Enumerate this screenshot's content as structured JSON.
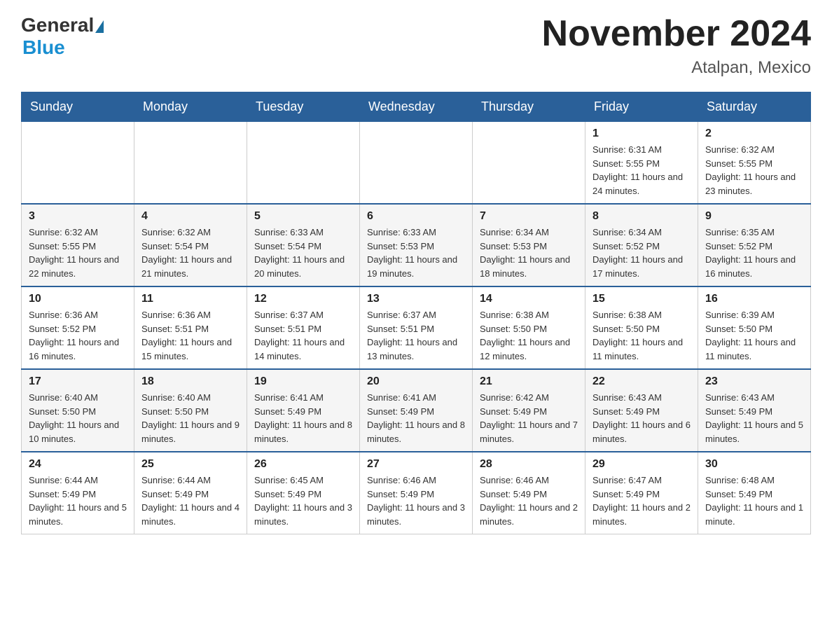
{
  "header": {
    "logo_general": "General",
    "logo_blue": "Blue",
    "title": "November 2024",
    "subtitle": "Atalpan, Mexico"
  },
  "days_of_week": [
    "Sunday",
    "Monday",
    "Tuesday",
    "Wednesday",
    "Thursday",
    "Friday",
    "Saturday"
  ],
  "weeks": [
    [
      {
        "day": "",
        "info": ""
      },
      {
        "day": "",
        "info": ""
      },
      {
        "day": "",
        "info": ""
      },
      {
        "day": "",
        "info": ""
      },
      {
        "day": "",
        "info": ""
      },
      {
        "day": "1",
        "info": "Sunrise: 6:31 AM\nSunset: 5:55 PM\nDaylight: 11 hours and 24 minutes."
      },
      {
        "day": "2",
        "info": "Sunrise: 6:32 AM\nSunset: 5:55 PM\nDaylight: 11 hours and 23 minutes."
      }
    ],
    [
      {
        "day": "3",
        "info": "Sunrise: 6:32 AM\nSunset: 5:55 PM\nDaylight: 11 hours and 22 minutes."
      },
      {
        "day": "4",
        "info": "Sunrise: 6:32 AM\nSunset: 5:54 PM\nDaylight: 11 hours and 21 minutes."
      },
      {
        "day": "5",
        "info": "Sunrise: 6:33 AM\nSunset: 5:54 PM\nDaylight: 11 hours and 20 minutes."
      },
      {
        "day": "6",
        "info": "Sunrise: 6:33 AM\nSunset: 5:53 PM\nDaylight: 11 hours and 19 minutes."
      },
      {
        "day": "7",
        "info": "Sunrise: 6:34 AM\nSunset: 5:53 PM\nDaylight: 11 hours and 18 minutes."
      },
      {
        "day": "8",
        "info": "Sunrise: 6:34 AM\nSunset: 5:52 PM\nDaylight: 11 hours and 17 minutes."
      },
      {
        "day": "9",
        "info": "Sunrise: 6:35 AM\nSunset: 5:52 PM\nDaylight: 11 hours and 16 minutes."
      }
    ],
    [
      {
        "day": "10",
        "info": "Sunrise: 6:36 AM\nSunset: 5:52 PM\nDaylight: 11 hours and 16 minutes."
      },
      {
        "day": "11",
        "info": "Sunrise: 6:36 AM\nSunset: 5:51 PM\nDaylight: 11 hours and 15 minutes."
      },
      {
        "day": "12",
        "info": "Sunrise: 6:37 AM\nSunset: 5:51 PM\nDaylight: 11 hours and 14 minutes."
      },
      {
        "day": "13",
        "info": "Sunrise: 6:37 AM\nSunset: 5:51 PM\nDaylight: 11 hours and 13 minutes."
      },
      {
        "day": "14",
        "info": "Sunrise: 6:38 AM\nSunset: 5:50 PM\nDaylight: 11 hours and 12 minutes."
      },
      {
        "day": "15",
        "info": "Sunrise: 6:38 AM\nSunset: 5:50 PM\nDaylight: 11 hours and 11 minutes."
      },
      {
        "day": "16",
        "info": "Sunrise: 6:39 AM\nSunset: 5:50 PM\nDaylight: 11 hours and 11 minutes."
      }
    ],
    [
      {
        "day": "17",
        "info": "Sunrise: 6:40 AM\nSunset: 5:50 PM\nDaylight: 11 hours and 10 minutes."
      },
      {
        "day": "18",
        "info": "Sunrise: 6:40 AM\nSunset: 5:50 PM\nDaylight: 11 hours and 9 minutes."
      },
      {
        "day": "19",
        "info": "Sunrise: 6:41 AM\nSunset: 5:49 PM\nDaylight: 11 hours and 8 minutes."
      },
      {
        "day": "20",
        "info": "Sunrise: 6:41 AM\nSunset: 5:49 PM\nDaylight: 11 hours and 8 minutes."
      },
      {
        "day": "21",
        "info": "Sunrise: 6:42 AM\nSunset: 5:49 PM\nDaylight: 11 hours and 7 minutes."
      },
      {
        "day": "22",
        "info": "Sunrise: 6:43 AM\nSunset: 5:49 PM\nDaylight: 11 hours and 6 minutes."
      },
      {
        "day": "23",
        "info": "Sunrise: 6:43 AM\nSunset: 5:49 PM\nDaylight: 11 hours and 5 minutes."
      }
    ],
    [
      {
        "day": "24",
        "info": "Sunrise: 6:44 AM\nSunset: 5:49 PM\nDaylight: 11 hours and 5 minutes."
      },
      {
        "day": "25",
        "info": "Sunrise: 6:44 AM\nSunset: 5:49 PM\nDaylight: 11 hours and 4 minutes."
      },
      {
        "day": "26",
        "info": "Sunrise: 6:45 AM\nSunset: 5:49 PM\nDaylight: 11 hours and 3 minutes."
      },
      {
        "day": "27",
        "info": "Sunrise: 6:46 AM\nSunset: 5:49 PM\nDaylight: 11 hours and 3 minutes."
      },
      {
        "day": "28",
        "info": "Sunrise: 6:46 AM\nSunset: 5:49 PM\nDaylight: 11 hours and 2 minutes."
      },
      {
        "day": "29",
        "info": "Sunrise: 6:47 AM\nSunset: 5:49 PM\nDaylight: 11 hours and 2 minutes."
      },
      {
        "day": "30",
        "info": "Sunrise: 6:48 AM\nSunset: 5:49 PM\nDaylight: 11 hours and 1 minute."
      }
    ]
  ]
}
